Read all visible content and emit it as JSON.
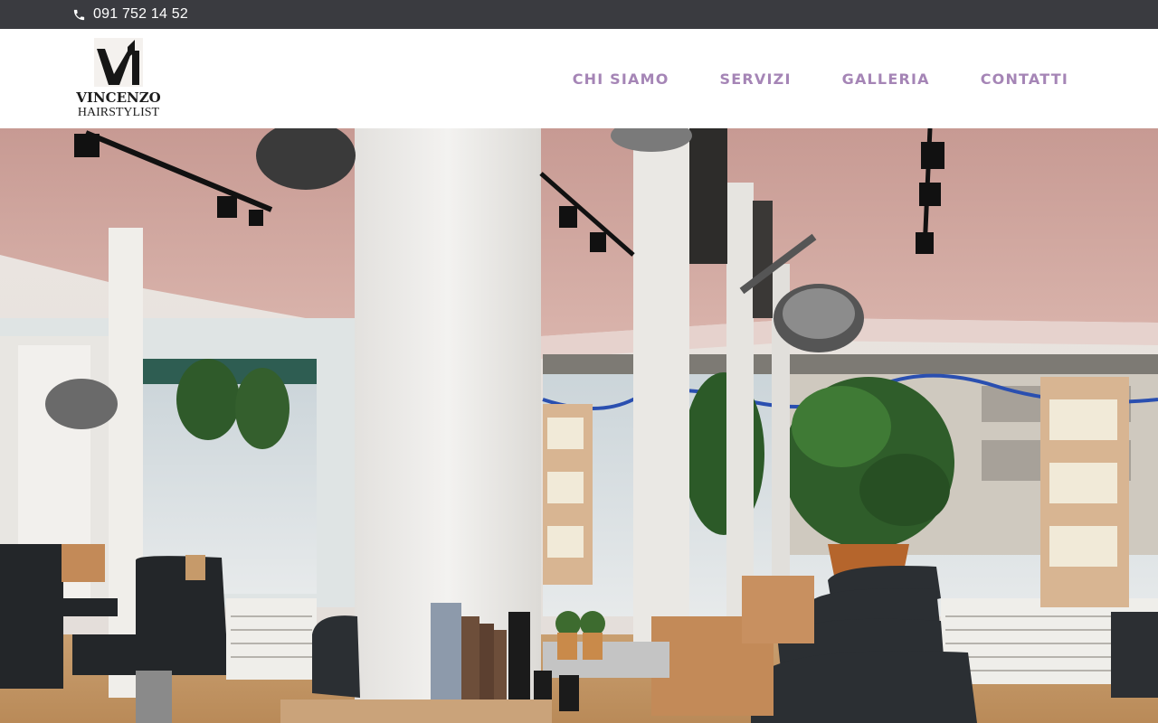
{
  "topbar": {
    "phone_icon": "phone-icon",
    "phone_number": "091 752 14 52"
  },
  "logo": {
    "name": "VINCENZO",
    "subtitle": "HAIRSTYLIST"
  },
  "nav": {
    "items": [
      {
        "label": "CHI SIAMO"
      },
      {
        "label": "SERVIZI"
      },
      {
        "label": "GALLERIA"
      },
      {
        "label": "CONTATTI"
      }
    ]
  },
  "hero": {
    "image": "salon-interior-photo"
  },
  "colors": {
    "topbar_bg": "#3a3b40",
    "nav_accent": "#a585b6",
    "logo_text": "#1c1c1c"
  }
}
